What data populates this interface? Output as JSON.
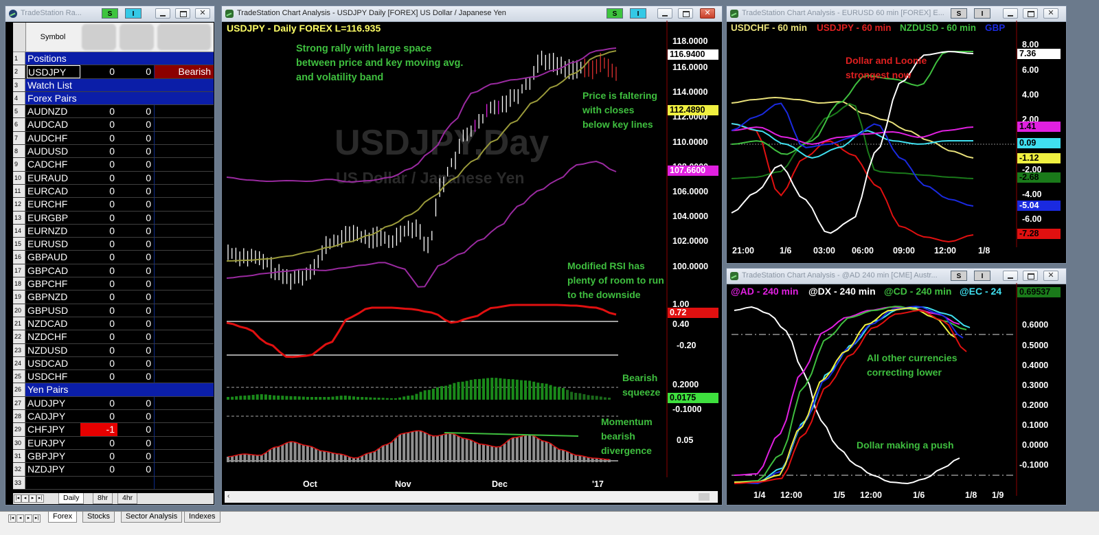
{
  "left_window": {
    "title": "TradeStation Ra...",
    "header_symbol": "Symbol",
    "s_label": "S",
    "i_label": "I",
    "rows": [
      {
        "n": "1",
        "name": "Positions",
        "type": "section"
      },
      {
        "n": "2",
        "name": "USDJPY",
        "a": "0",
        "b": "0",
        "c": "Bearish",
        "type": "row",
        "c_bg": "#8b0000",
        "selected": true
      },
      {
        "n": "3",
        "name": "Watch List",
        "type": "section"
      },
      {
        "n": "4",
        "name": "Forex Pairs",
        "type": "section"
      },
      {
        "n": "5",
        "name": "AUDNZD",
        "a": "0",
        "b": "0",
        "type": "row"
      },
      {
        "n": "6",
        "name": "AUDCAD",
        "a": "0",
        "b": "0",
        "type": "row"
      },
      {
        "n": "7",
        "name": "AUDCHF",
        "a": "0",
        "b": "0",
        "type": "row"
      },
      {
        "n": "8",
        "name": "AUDUSD",
        "a": "0",
        "b": "0",
        "type": "row"
      },
      {
        "n": "9",
        "name": "CADCHF",
        "a": "0",
        "b": "0",
        "type": "row"
      },
      {
        "n": "10",
        "name": "EURAUD",
        "a": "0",
        "b": "0",
        "type": "row"
      },
      {
        "n": "11",
        "name": "EURCAD",
        "a": "0",
        "b": "0",
        "type": "row"
      },
      {
        "n": "12",
        "name": "EURCHF",
        "a": "0",
        "b": "0",
        "type": "row"
      },
      {
        "n": "13",
        "name": "EURGBP",
        "a": "0",
        "b": "0",
        "type": "row"
      },
      {
        "n": "14",
        "name": "EURNZD",
        "a": "0",
        "b": "0",
        "type": "row"
      },
      {
        "n": "15",
        "name": "EURUSD",
        "a": "0",
        "b": "0",
        "type": "row"
      },
      {
        "n": "16",
        "name": "GBPAUD",
        "a": "0",
        "b": "0",
        "type": "row"
      },
      {
        "n": "17",
        "name": "GBPCAD",
        "a": "0",
        "b": "0",
        "type": "row"
      },
      {
        "n": "18",
        "name": "GBPCHF",
        "a": "0",
        "b": "0",
        "type": "row"
      },
      {
        "n": "19",
        "name": "GBPNZD",
        "a": "0",
        "b": "0",
        "type": "row"
      },
      {
        "n": "20",
        "name": "GBPUSD",
        "a": "0",
        "b": "0",
        "type": "row"
      },
      {
        "n": "21",
        "name": "NZDCAD",
        "a": "0",
        "b": "0",
        "type": "row"
      },
      {
        "n": "22",
        "name": "NZDCHF",
        "a": "0",
        "b": "0",
        "type": "row"
      },
      {
        "n": "23",
        "name": "NZDUSD",
        "a": "0",
        "b": "0",
        "type": "row"
      },
      {
        "n": "24",
        "name": "USDCAD",
        "a": "0",
        "b": "0",
        "type": "row"
      },
      {
        "n": "25",
        "name": "USDCHF",
        "a": "0",
        "b": "0",
        "type": "row"
      },
      {
        "n": "26",
        "name": "Yen Pairs",
        "type": "section"
      },
      {
        "n": "27",
        "name": "AUDJPY",
        "a": "0",
        "b": "0",
        "type": "row"
      },
      {
        "n": "28",
        "name": "CADJPY",
        "a": "0",
        "b": "0",
        "type": "row"
      },
      {
        "n": "29",
        "name": "CHFJPY",
        "a": "-1",
        "b": "0",
        "type": "row",
        "a_bg": "#e60000"
      },
      {
        "n": "30",
        "name": "EURJPY",
        "a": "0",
        "b": "0",
        "type": "row"
      },
      {
        "n": "31",
        "name": "GBPJPY",
        "a": "0",
        "b": "0",
        "type": "row"
      },
      {
        "n": "32",
        "name": "NZDJPY",
        "a": "0",
        "b": "0",
        "type": "row"
      },
      {
        "n": "33",
        "name": "",
        "type": "row"
      }
    ],
    "inner_tabs": [
      "Daily",
      "8hr",
      "4hr"
    ]
  },
  "bottom_tabs": [
    "Forex",
    "Stocks",
    "Sector Analysis",
    "Indexes"
  ],
  "main_chart": {
    "title": "TradeStation Chart Analysis - USDJPY Daily [FOREX] US Dollar / Japanese Yen",
    "s_label": "S",
    "i_label": "I",
    "header_text": "USDJPY - Daily  FOREX  L=116.935",
    "watermark_1": "USDJPY,Day",
    "watermark_2": "US Dollar / Japanese Yen",
    "annotations": {
      "a1": "Strong rally with large space",
      "a2": "between price and key moving avg.",
      "a3": "and volatility band",
      "b1": "Price is faltering",
      "b2": "with closes",
      "b3": "below key lines",
      "c1": "Modified RSI has",
      "c2": "plenty of room to run",
      "c3": "to the downside",
      "d1": "Bearish",
      "d2": "squeeze",
      "e1": "Momentum",
      "e2": "bearish",
      "e3": "divergence"
    },
    "price_axis": [
      "118.0000",
      "116.0000",
      "114.0000",
      "112.0000",
      "110.0000",
      "108.0000",
      "106.0000",
      "104.0000",
      "102.0000",
      "100.0000"
    ],
    "price_flags": {
      "last": "116.9400",
      "ma": "112.4890",
      "band": "107.6600"
    },
    "rsi_axis": [
      "1.00",
      "0.40",
      "-0.20"
    ],
    "rsi_flag": "0.72",
    "squeeze_axis": [
      "0.2000",
      "-0.1000"
    ],
    "squeeze_flag": "0.0175",
    "momentum_axis": [
      "0.05"
    ],
    "x_labels": [
      "Oct",
      "Nov",
      "Dec",
      "'17"
    ],
    "colors": {
      "price": "#ffffff",
      "ma": "#9a9a3a",
      "band": "#9a2aa0",
      "rsi": "#e01010",
      "squeeze": "#1a8a1a",
      "momentum": "#909090",
      "annotation": "#3fbf3f"
    }
  },
  "eurusd_chart": {
    "title": "TradeStation Chart Analysis - EURUSD 60 min [FOREX] E...",
    "s_label": "S",
    "i_label": "I",
    "legend": [
      {
        "text": "USDCHF - 60 min",
        "color": "#e8e07a"
      },
      {
        "text": "USDJPY - 60 min",
        "color": "#e02020"
      },
      {
        "text": "NZDUSD - 60 min",
        "color": "#3fbf3f"
      },
      {
        "text": "GBP",
        "color": "#1a2ae0"
      }
    ],
    "annotation_1": "Dollar and Loonie",
    "annotation_2": "strongest now",
    "y_axis": [
      "8.00",
      "6.00",
      "4.00",
      "2.00",
      "-2.00",
      "-4.00",
      "-6.00"
    ],
    "flags": [
      {
        "text": "7.36",
        "bg": "#ffffff",
        "fg": "#000"
      },
      {
        "text": "1.41",
        "bg": "#e020e0",
        "fg": "#000"
      },
      {
        "text": "0.09",
        "bg": "#40e0f0",
        "fg": "#000"
      },
      {
        "text": "-1.12",
        "bg": "#f0f040",
        "fg": "#000"
      },
      {
        "text": "-2.68",
        "bg": "#1a7a1a",
        "fg": "#000"
      },
      {
        "text": "-5.04",
        "bg": "#1a2ae0",
        "fg": "#fff"
      },
      {
        "text": "-7.28",
        "bg": "#e01010",
        "fg": "#000"
      }
    ],
    "x_labels": [
      "21:00",
      "1/6",
      "03:00",
      "06:00",
      "09:00",
      "12:00",
      "1/8"
    ]
  },
  "ad_chart": {
    "title": "TradeStation Chart Analysis - @AD 240 min [CME] Austr...",
    "s_label": "S",
    "i_label": "I",
    "legend": [
      {
        "text": "@AD - 240 min",
        "color": "#e020e0"
      },
      {
        "text": "@DX - 240 min",
        "color": "#ffffff"
      },
      {
        "text": "@CD - 240 min",
        "color": "#3fbf3f"
      },
      {
        "text": "@EC - 24",
        "color": "#40e0f0"
      }
    ],
    "annotation_1": "All other currencies",
    "annotation_2": "correcting lower",
    "annotation_3": "Dollar making a push",
    "y_axis": [
      "0.6000",
      "0.5000",
      "0.4000",
      "0.3000",
      "0.2000",
      "0.1000",
      "0.0000",
      "-0.1000"
    ],
    "flag": "0.69537",
    "x_labels": [
      "1/4",
      "12:00",
      "1/5",
      "12:00",
      "1/6",
      "1/8",
      "1/9"
    ]
  }
}
